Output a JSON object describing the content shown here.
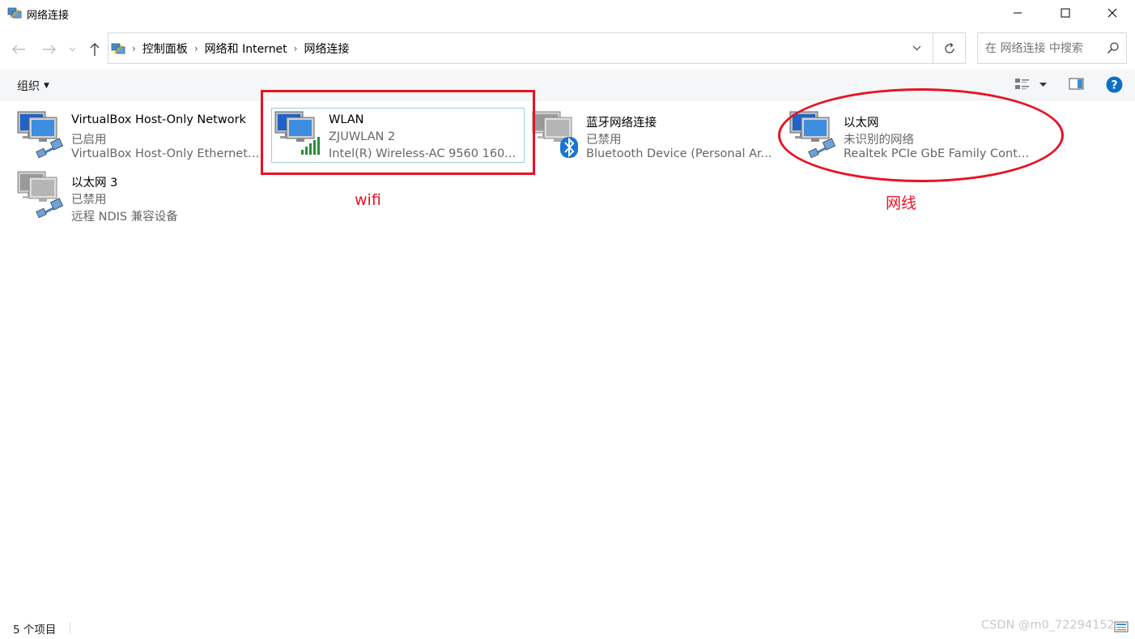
{
  "window": {
    "title": "网络连接"
  },
  "breadcrumb": {
    "items": [
      "控制面板",
      "网络和 Internet",
      "网络连接"
    ]
  },
  "search": {
    "placeholder": "在 网络连接 中搜索"
  },
  "toolbar": {
    "organize_label": "组织"
  },
  "connections": [
    {
      "name": "VirtualBox Host-Only Network",
      "status": "已启用",
      "device": "VirtualBox Host-Only Ethernet ..."
    },
    {
      "name": "WLAN",
      "status": "ZJUWLAN 2",
      "device": "Intel(R) Wireless-AC 9560 160..."
    },
    {
      "name": "蓝牙网络连接",
      "status": "已禁用",
      "device": "Bluetooth Device (Personal Ar..."
    },
    {
      "name": "以太网",
      "status": "未识别的网络",
      "device": "Realtek PCIe GbE Family Contr..."
    },
    {
      "name": "以太网 3",
      "status": "已禁用",
      "device": "远程 NDIS 兼容设备"
    }
  ],
  "annotations": {
    "wifi_label": "wifi",
    "ethernet_label": "网线",
    "color": "#e81224"
  },
  "status": {
    "item_count": "5 个项目"
  },
  "watermark": "CSDN @m0_72294152",
  "colors": {
    "accent": "#0078d7",
    "selection_border": "#99d1d3"
  },
  "icons": {
    "app": "network-connections-icon",
    "back": "back-arrow-icon",
    "forward": "forward-arrow-icon",
    "up": "up-arrow-icon",
    "refresh": "refresh-icon",
    "search": "search-icon",
    "help": "help-icon",
    "wifi": "wifi-signal-icon",
    "bluetooth": "bluetooth-icon",
    "cable": "network-cable-icon"
  }
}
